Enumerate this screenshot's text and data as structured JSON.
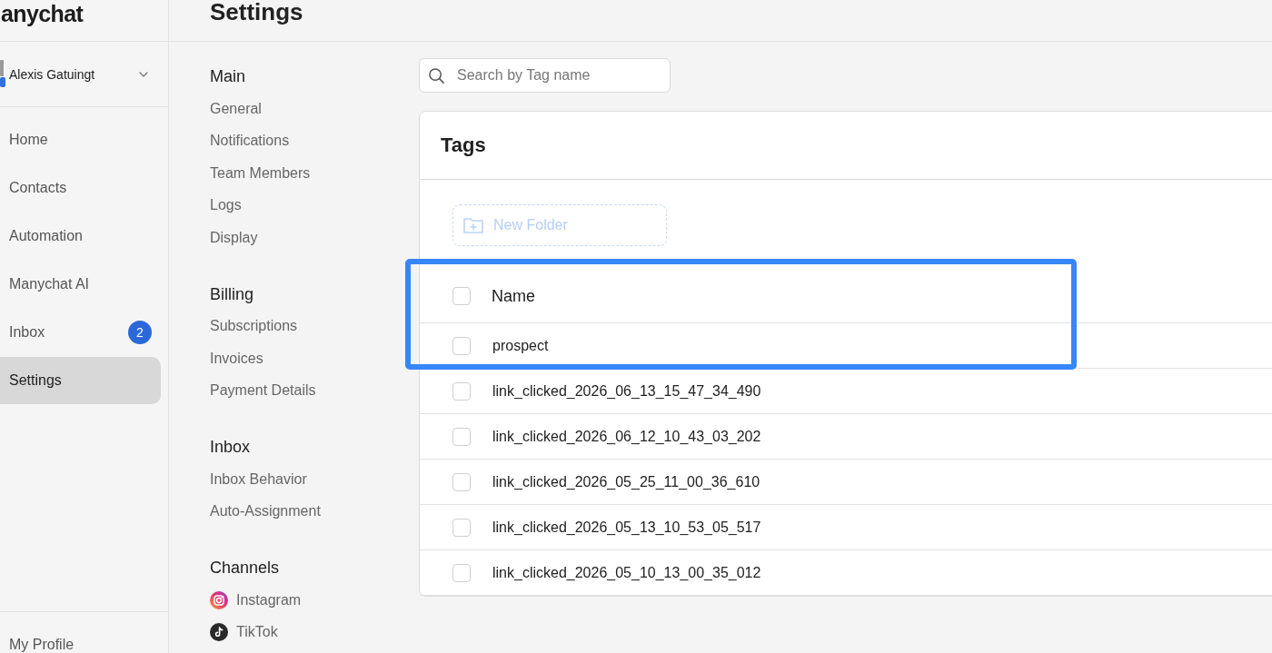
{
  "sidebar": {
    "logo": "anychat",
    "account": {
      "name": "Alexis Gatuingt"
    },
    "nav": [
      {
        "label": "Home",
        "selected": false
      },
      {
        "label": "Contacts",
        "selected": false
      },
      {
        "label": "Automation",
        "selected": false
      },
      {
        "label": "Manychat AI",
        "selected": false
      },
      {
        "label": "Inbox",
        "selected": false,
        "badge": "2"
      },
      {
        "label": "Settings",
        "selected": true
      }
    ],
    "footer": {
      "label": "My Profile"
    }
  },
  "header": {
    "title": "Settings"
  },
  "settings_nav": [
    {
      "heading": "Main",
      "items": [
        {
          "label": "General"
        },
        {
          "label": "Notifications"
        },
        {
          "label": "Team Members"
        },
        {
          "label": "Logs"
        },
        {
          "label": "Display"
        }
      ]
    },
    {
      "heading": "Billing",
      "items": [
        {
          "label": "Subscriptions"
        },
        {
          "label": "Invoices"
        },
        {
          "label": "Payment Details"
        }
      ]
    },
    {
      "heading": "Inbox",
      "items": [
        {
          "label": "Inbox Behavior"
        },
        {
          "label": "Auto-Assignment"
        }
      ]
    },
    {
      "heading": "Channels",
      "items": [
        {
          "label": "Instagram",
          "kind": "instagram"
        },
        {
          "label": "TikTok",
          "kind": "tiktok"
        }
      ]
    }
  ],
  "search": {
    "placeholder": "Search by Tag name"
  },
  "tags_panel": {
    "title": "Tags",
    "new_folder_button": "New Folder",
    "table": {
      "header": {
        "label": "Name",
        "checked": false,
        "highlighted": true
      },
      "rows": [
        {
          "name": "prospect",
          "checked": false,
          "highlighted": true
        },
        {
          "name": "link_clicked_2026_06_13_15_47_34_490",
          "checked": false,
          "highlighted": false
        },
        {
          "name": "link_clicked_2026_06_12_10_43_03_202",
          "checked": false,
          "highlighted": false
        },
        {
          "name": "link_clicked_2026_05_25_11_00_36_610",
          "checked": false,
          "highlighted": false
        },
        {
          "name": "link_clicked_2026_05_13_10_53_05_517",
          "checked": false,
          "highlighted": false
        },
        {
          "name": "link_clicked_2026_05_10_13_00_35_012",
          "checked": false,
          "highlighted": false
        }
      ]
    }
  }
}
